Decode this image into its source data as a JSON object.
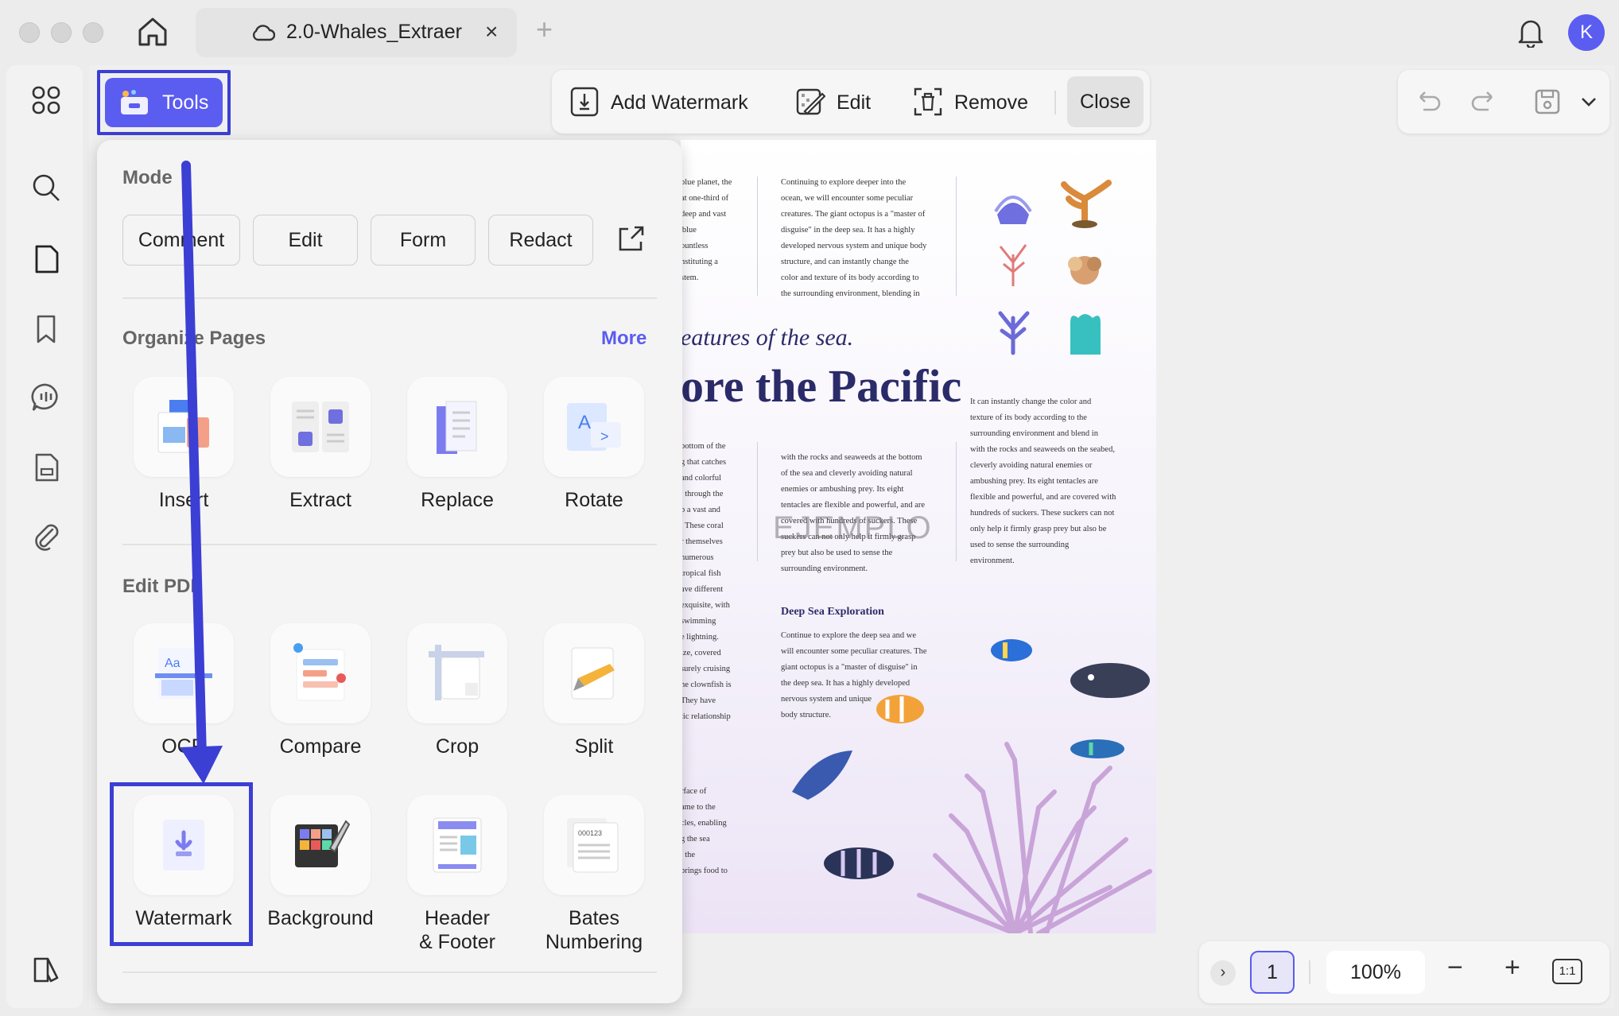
{
  "tab": {
    "title": "2.0-Whales_Extraer",
    "close_glyph": "×",
    "new_glyph": "+"
  },
  "user": {
    "initial": "K"
  },
  "tools_button": {
    "label": "Tools"
  },
  "watermark_toolbar": {
    "add_label": "Add Watermark",
    "edit_label": "Edit",
    "remove_label": "Remove",
    "close_label": "Close"
  },
  "panel": {
    "mode": {
      "title": "Mode",
      "buttons": [
        "Comment",
        "Edit",
        "Form",
        "Redact"
      ]
    },
    "organize": {
      "title": "Organize Pages",
      "more_label": "More",
      "tools": [
        "Insert",
        "Extract",
        "Replace",
        "Rotate"
      ]
    },
    "edit_pdf": {
      "title": "Edit PDF",
      "tools": [
        "OCR",
        "Compare",
        "Crop",
        "Split",
        "Watermark",
        "Background",
        "Header\n& Footer",
        "Bates\nNumbering"
      ]
    }
  },
  "document": {
    "col1_top": "blue planet, the\nat one-third of\ndeep and vast\n'blue\nountless\nnstituting a\nstem.",
    "col2_top": "Continuing to explore deeper into the\nocean, we will encounter some peculiar\ncreatures. The giant octopus is a \"master of\ndisguise\" in the deep sea. It has a highly\ndeveloped nervous system and unique body\nstructure, and can instantly change the\ncolor and texture of its body according to\nthe surrounding environment, blending in",
    "subtitle": "eatures of the sea.",
    "title": "ore the Pacific",
    "col1_mid": "bottom of the\ng that catches\nand colorful\n, through the\np a vast and\n. These coral\nr themselves\nnumerous\ntropical fish\nave different\nexquisite, with\nswimming\ne lightning.\nize, covered\nsurely cruising\nhe clownfish is\nThey have\ntic relationship",
    "col2_mid": "with the rocks and seaweeds at the bottom\nof the sea and cleverly avoiding natural\nenemies or ambushing prey. Its eight\ntentacles are flexible and powerful, and are\ncovered with hundreds of suckers. These\nsuckers can not only help it firmly grasp\nprey but also be used to sense the\nsurrounding environment.",
    "col3_mid": "It can instantly change the color and\ntexture of its body according to the\nsurrounding environment and blend in\nwith the rocks and seaweeds on the seabed,\ncleverly avoiding natural enemies or\nambushing prey. Its eight tentacles are\nflexible and powerful, and are covered with\nhundreds of suckers. These suckers can not\nonly help it firmly grasp prey but also be\nused to sense the surrounding\nenvironment.",
    "deep_title": "Deep Sea Exploration",
    "deep_text": "Continue to explore the deep sea and we\nwill encounter some peculiar creatures. The\ngiant octopus is a \"master of disguise\" in\nthe deep sea. It has a highly developed\nnervous system and unique\nbody structure.",
    "col1_bottom": "rface of\name to the\ncles, enabling\ng the sea\n, the\nbrings food to",
    "watermark_text": "EJEMPLO"
  },
  "bottom_bar": {
    "next_glyph": "›",
    "page": "1",
    "zoom": "100%",
    "minus": "−",
    "plus": "+",
    "fit": "1:1"
  },
  "colors": {
    "accent": "#5b5cf0",
    "highlight": "#3b3fd4"
  }
}
